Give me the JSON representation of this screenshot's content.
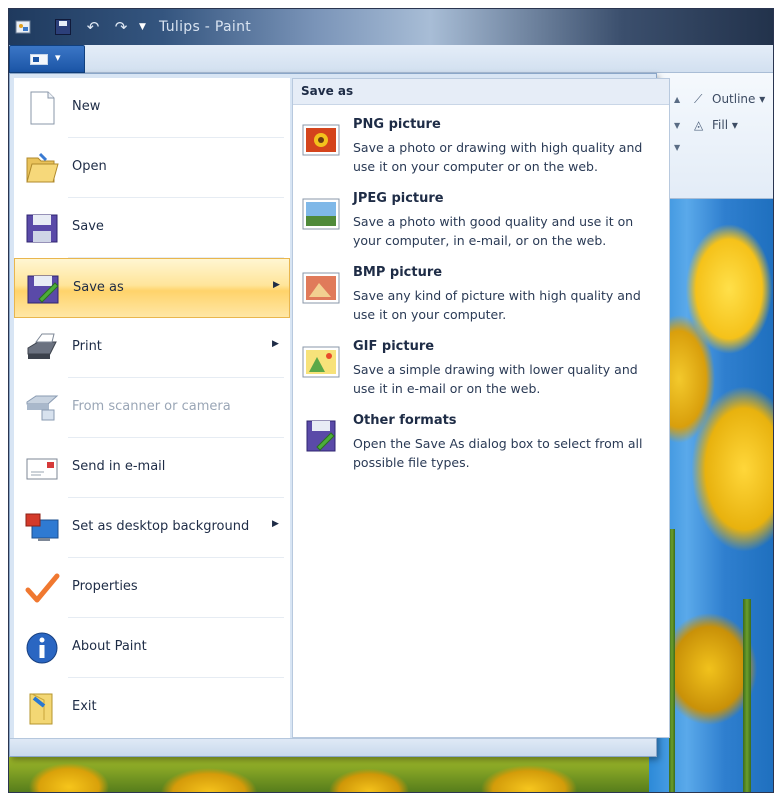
{
  "window": {
    "title": "Tulips - Paint"
  },
  "app_menu": {
    "items": [
      {
        "label": "New",
        "icon": "new-document-icon",
        "has_submenu": false,
        "disabled": false
      },
      {
        "label": "Open",
        "icon": "open-folder-icon",
        "has_submenu": false,
        "disabled": false
      },
      {
        "label": "Save",
        "icon": "floppy-disk-icon",
        "has_submenu": false,
        "disabled": false
      },
      {
        "label": "Save as",
        "icon": "save-as-icon",
        "has_submenu": true,
        "disabled": false,
        "selected": true
      },
      {
        "label": "Print",
        "icon": "printer-icon",
        "has_submenu": true,
        "disabled": false
      },
      {
        "label": "From scanner or camera",
        "icon": "scanner-icon",
        "has_submenu": false,
        "disabled": true
      },
      {
        "label": "Send in e-mail",
        "icon": "email-icon",
        "has_submenu": false,
        "disabled": false
      },
      {
        "label": "Set as desktop background",
        "icon": "desktop-background-icon",
        "has_submenu": true,
        "disabled": false
      },
      {
        "label": "Properties",
        "icon": "checkmark-icon",
        "has_submenu": false,
        "disabled": false
      },
      {
        "label": "About Paint",
        "icon": "info-icon",
        "has_submenu": false,
        "disabled": false
      },
      {
        "label": "Exit",
        "icon": "exit-icon",
        "has_submenu": false,
        "disabled": false
      }
    ]
  },
  "save_as_panel": {
    "header": "Save as",
    "formats": [
      {
        "name": "PNG picture",
        "description": "Save a photo or drawing with high quality and use it on your computer or on the web.",
        "icon": "png-picture-icon"
      },
      {
        "name": "JPEG picture",
        "description": "Save a photo with good quality and use it on your computer, in e-mail, or on the web.",
        "icon": "jpeg-picture-icon"
      },
      {
        "name": "BMP picture",
        "description": "Save any kind of picture with high quality and use it on your computer.",
        "icon": "bmp-picture-icon"
      },
      {
        "name": "GIF picture",
        "description": "Save a simple drawing with lower quality and use it in e-mail or on the web.",
        "icon": "gif-picture-icon"
      },
      {
        "name": "Other formats",
        "description": "Open the Save As dialog box to select from all possible file types.",
        "icon": "other-formats-icon"
      }
    ]
  },
  "ribbon": {
    "outline_label": "Outline",
    "fill_label": "Fill"
  }
}
